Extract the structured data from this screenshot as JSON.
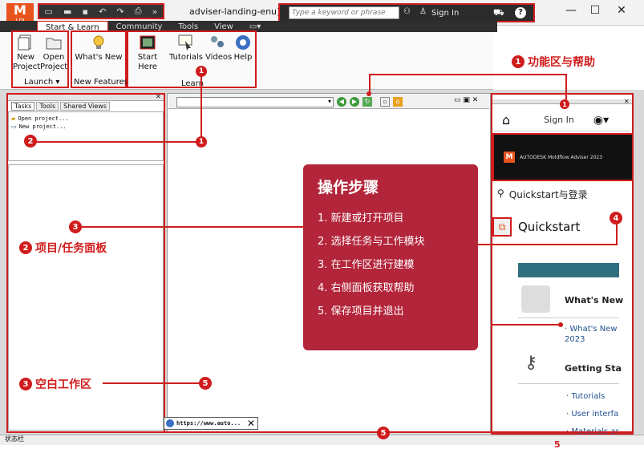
{
  "window": {
    "title": "adviser-landing-enu]",
    "app_logo": "M",
    "app_logo_sub": "LDI",
    "search_placeholder": "Type a keyword or phrase",
    "sign_in": "Sign In",
    "controls": {
      "minimize": "—",
      "maximize": "☐",
      "close": "✕"
    }
  },
  "ribbon": {
    "tabs": [
      "Start & Learn",
      "Community",
      "Tools",
      "View"
    ],
    "groups": [
      {
        "label": "Launch ▾",
        "buttons": [
          "New\nProject",
          "Open\nProject"
        ]
      },
      {
        "label": "New Features",
        "buttons": [
          "What's New"
        ]
      },
      {
        "label": "Learn",
        "buttons": [
          "Start Here",
          "Tutorials",
          "Videos",
          "Help"
        ]
      }
    ]
  },
  "left_panel": {
    "tabs": [
      "Tasks",
      "Tools",
      "Shared Views"
    ],
    "items": [
      "Open project...",
      "New project..."
    ]
  },
  "browser": {
    "url": "https://www.auto..."
  },
  "steps_card": {
    "title": "操作步骤",
    "steps": [
      "1. 新建或打开项目",
      "2. 选择任务与工作模块",
      "3. 在工作区进行建模",
      "4. 右侧面板获取帮助",
      "5. 保存项目并退出"
    ]
  },
  "right_panel": {
    "sign_in": "Sign In",
    "banner_text": "AUTODESK Moldflow Adviser 2023",
    "search_label": "Quickstart与登录",
    "quickstart": "Quickstart",
    "whats_new": {
      "title": "What's New",
      "link": "· What's New 2023"
    },
    "getting_started": {
      "title": "Getting Start",
      "links": [
        "· Tutorials",
        "· User interfa",
        "· Materials ar"
      ]
    }
  },
  "status_bar": {
    "text": "状态栏"
  },
  "callouts": {
    "c1": {
      "num": "1",
      "label": "功能区与帮助"
    },
    "c2": {
      "num": "2",
      "label": "项目/任务面板"
    },
    "c3": {
      "num": "3",
      "label": "空白工作区"
    },
    "n2": "2",
    "n3": "3",
    "n4": "4",
    "n5a": "5",
    "n5b": "5",
    "n5c": "5",
    "n1a": "1",
    "n1b": "1"
  },
  "colors": {
    "annotation": "#d01c1c",
    "card": "#b3253a",
    "teal": "#2f6f7f",
    "title_orange": "#e8541e"
  }
}
